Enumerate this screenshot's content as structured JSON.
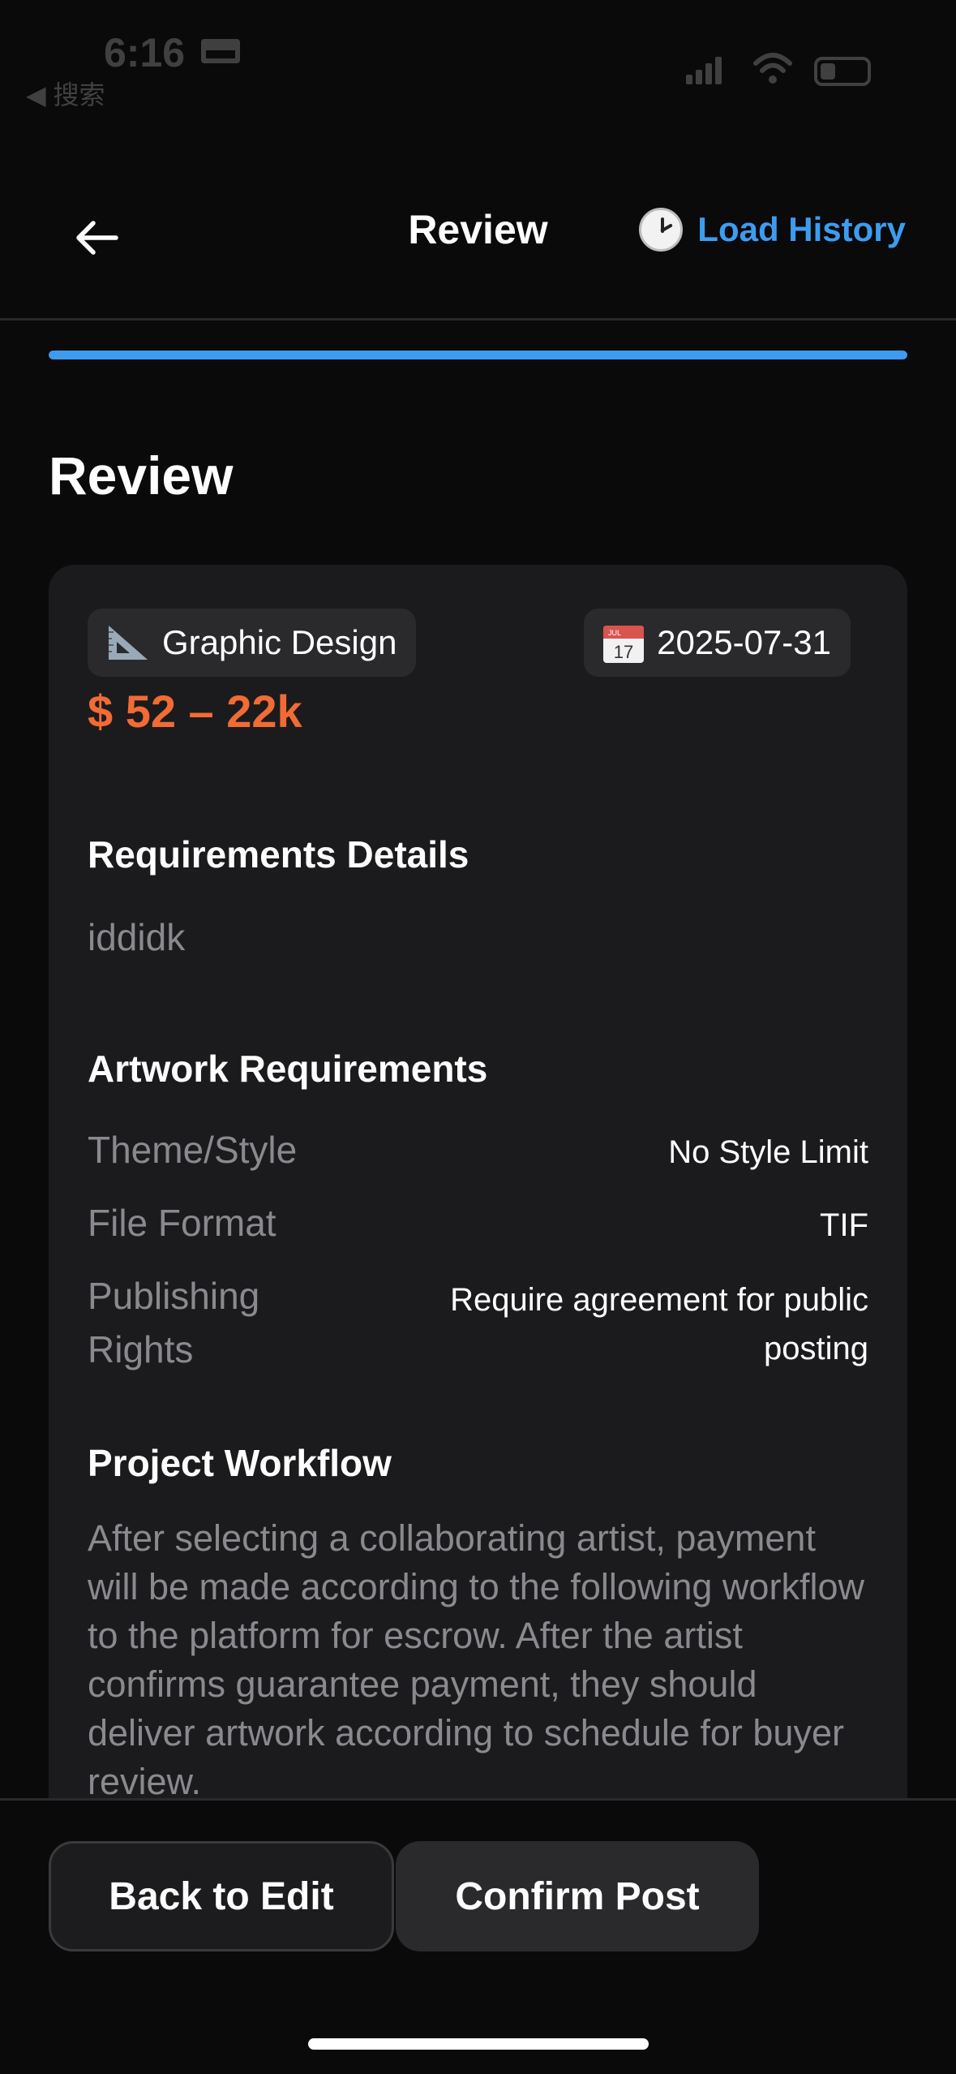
{
  "status_bar": {
    "time": "6:16",
    "back_app": "◀ 搜索"
  },
  "header": {
    "title": "Review",
    "load_history_label": "Load History"
  },
  "progress": {
    "fraction": 1.0
  },
  "page_heading": "Review",
  "summary": {
    "category_label": "Graphic Design",
    "category_icon": "triangle-ruler-icon",
    "date_label": "2025-07-31",
    "date_icon": "calendar-icon",
    "calendar_month": "JUL",
    "calendar_day": "17",
    "price": "$ 52 – 22k"
  },
  "requirements_details": {
    "title": "Requirements Details",
    "text": "iddidk"
  },
  "artwork_requirements": {
    "title": "Artwork Requirements",
    "rows": [
      {
        "label": "Theme/Style",
        "value": "No Style Limit"
      },
      {
        "label": "File Format",
        "value": "TIF"
      },
      {
        "label": "Publishing Rights",
        "value": "Require agreement for public posting"
      }
    ]
  },
  "project_workflow": {
    "title": "Project Workflow",
    "text": "After selecting a collaborating artist, payment will be made according to the following workflow to the platform for escrow. After the artist confirms guarantee payment, they should deliver artwork according to schedule for buyer review."
  },
  "actions": {
    "back_to_edit": "Back to Edit",
    "confirm_post": "Confirm Post"
  },
  "colors": {
    "accent_blue": "#3d9cf0",
    "price_orange": "#f26b35",
    "card_bg": "#1b1b1d"
  }
}
